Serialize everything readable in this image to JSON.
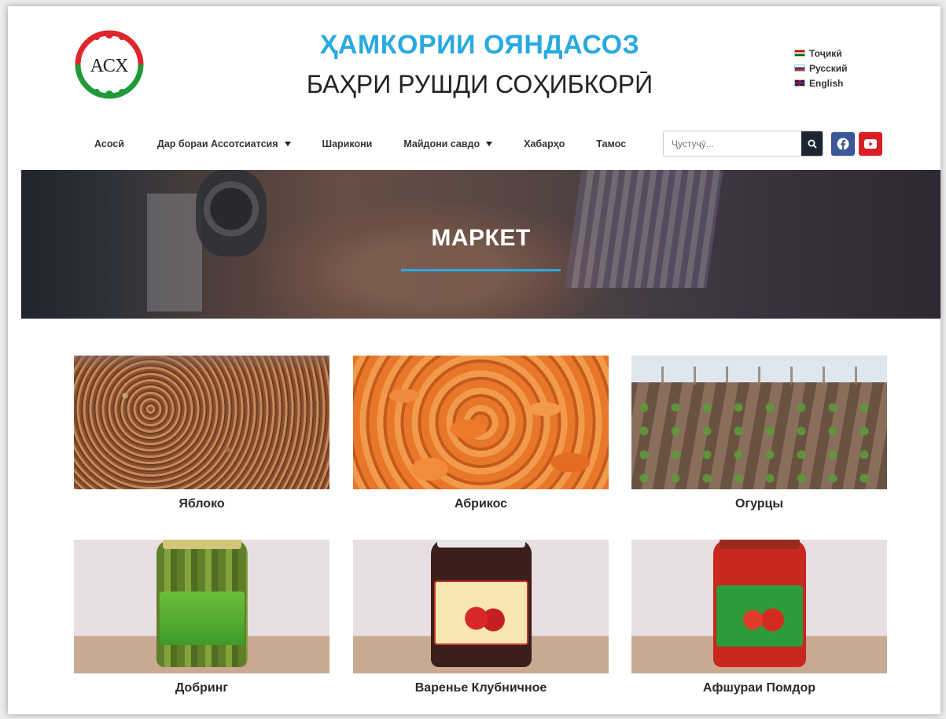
{
  "header": {
    "logo_text": "АСХ",
    "title_line1": "ҲАМКОРИИ ОЯНДАСОЗ",
    "title_line2": "БАҲРИ РУШДИ СОҲИБКОРӢ",
    "languages": [
      {
        "label": "Тоҷикӣ",
        "flag": "tj"
      },
      {
        "label": "Русский",
        "flag": "ru"
      },
      {
        "label": "English",
        "flag": "en"
      }
    ]
  },
  "nav": {
    "items": [
      {
        "label": "Асосӣ",
        "dropdown": false
      },
      {
        "label": "Дар бораи Ассотсиатсия",
        "dropdown": true
      },
      {
        "label": "Шарикони",
        "dropdown": false
      },
      {
        "label": "Майдони савдо",
        "dropdown": true
      },
      {
        "label": "Хабарҳо",
        "dropdown": false
      },
      {
        "label": "Тамос",
        "dropdown": false
      }
    ],
    "search": {
      "placeholder": "Ҷустуҷӯ...",
      "value": ""
    },
    "social": [
      "facebook-icon",
      "youtube-icon"
    ]
  },
  "banner": {
    "title": "МАРКЕТ"
  },
  "products": [
    {
      "name": "Яблоко"
    },
    {
      "name": "Абрикос"
    },
    {
      "name": "Огурцы"
    },
    {
      "name": "Добринг"
    },
    {
      "name": "Варенье Клубничное"
    },
    {
      "name": "Афшураи Помдор"
    }
  ],
  "colors": {
    "accent": "#29a9e1",
    "facebook": "#3b5998",
    "youtube": "#d81f26",
    "search_button": "#1e2530"
  }
}
